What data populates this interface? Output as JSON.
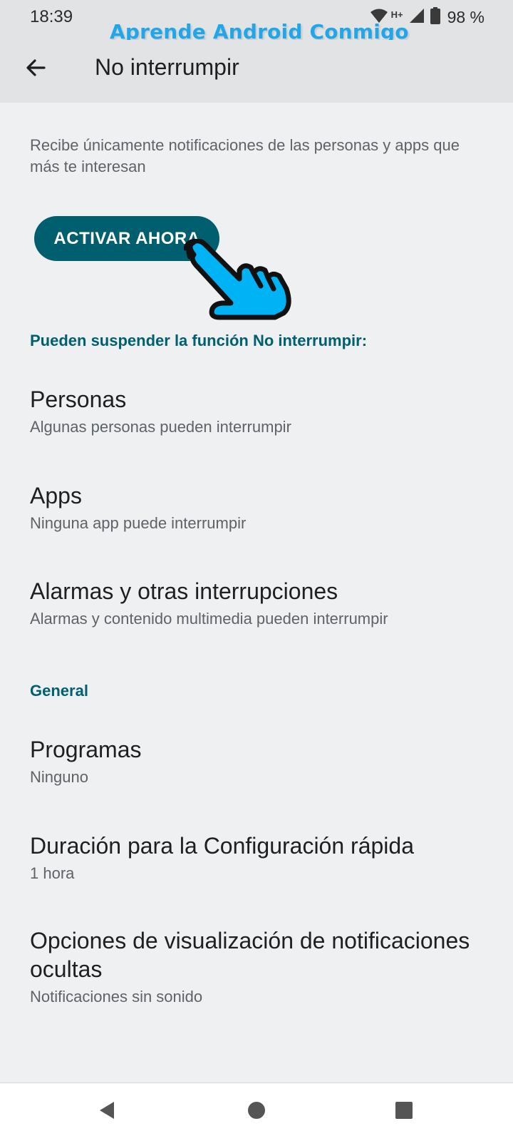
{
  "status_bar": {
    "time": "18:39",
    "network_label": "H+",
    "battery_text": "98 %",
    "icons": [
      "wifi-icon",
      "signal-icon",
      "battery-icon"
    ]
  },
  "watermark": "Aprende Android Conmigo",
  "app_bar": {
    "title": "No interrumpir",
    "back_icon": "arrow-left-icon"
  },
  "description": "Recibe únicamente notificaciones de las personas y apps que más te interesan",
  "primary_button": {
    "label": "ACTIVAR AHORA"
  },
  "sections": {
    "interrupt_header": "Pueden suspender la función No interrumpir:",
    "general_header": "General"
  },
  "items": [
    {
      "title": "Personas",
      "subtitle": "Algunas personas pueden interrumpir"
    },
    {
      "title": "Apps",
      "subtitle": "Ninguna app puede interrumpir"
    },
    {
      "title": "Alarmas y otras interrupciones",
      "subtitle": "Alarmas y contenido multimedia pueden interrumpir"
    },
    {
      "title": "Programas",
      "subtitle": "Ninguno"
    },
    {
      "title": "Duración para la Configuración rápida",
      "subtitle": "1 hora"
    },
    {
      "title": "Opciones de visualización de notificaciones ocultas",
      "subtitle": "Notificaciones sin sonido"
    }
  ],
  "nav_bar": {
    "icons": [
      "back-triangle-icon",
      "home-circle-icon",
      "recents-square-icon"
    ]
  },
  "colors": {
    "accent": "#005f6f",
    "section_header": "#006071",
    "background": "#eef0f2",
    "app_bar": "#e2e3e5",
    "hand_cursor": "#00b3f5",
    "watermark": "#22a6ea"
  }
}
